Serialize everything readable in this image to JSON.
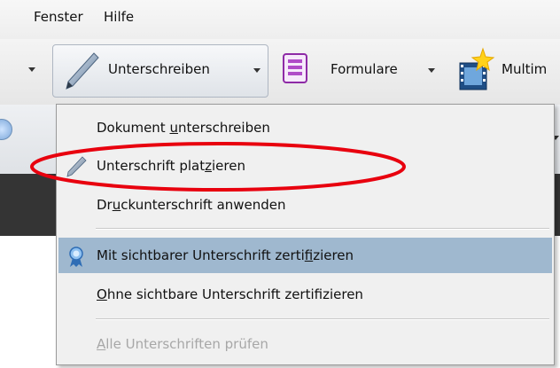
{
  "menubar": {
    "items": [
      {
        "label": "Fenster"
      },
      {
        "label": "Hilfe"
      }
    ]
  },
  "toolbar": {
    "sign": {
      "label": "Unterschreiben"
    },
    "forms": {
      "label": "Formulare"
    },
    "multimedia": {
      "label": "Multim"
    }
  },
  "sign_menu": {
    "items": [
      {
        "pre": "Dokument ",
        "mnemonic": "u",
        "post": "nterschreiben",
        "state": "normal",
        "icon": ""
      },
      {
        "pre": "Unterschrift plat",
        "mnemonic": "z",
        "post": "ieren",
        "state": "normal",
        "icon": "pen-icon"
      },
      {
        "pre": "Dr",
        "mnemonic": "u",
        "post": "ckunterschrift anwenden",
        "state": "normal",
        "icon": ""
      },
      {
        "pre": "Mit sichtbarer Unterschrift zerti",
        "mnemonic": "f",
        "post": "izieren",
        "state": "highlighted",
        "icon": "ribbon-certificate-icon"
      },
      {
        "pre": "",
        "mnemonic": "O",
        "post": "hne sichtbare Unterschrift zertifizieren",
        "state": "normal",
        "icon": ""
      },
      {
        "pre": "",
        "mnemonic": "A",
        "post": "lle Unterschriften prüfen",
        "state": "disabled",
        "icon": ""
      }
    ]
  },
  "annotation": {
    "shape": "ellipse",
    "color": "#e8000e",
    "target": "Unterschrift platzieren"
  },
  "colors": {
    "menu_highlight": "#9fb8cf",
    "menu_background": "#f0f0f0",
    "disabled_text": "#a7a7a7"
  }
}
